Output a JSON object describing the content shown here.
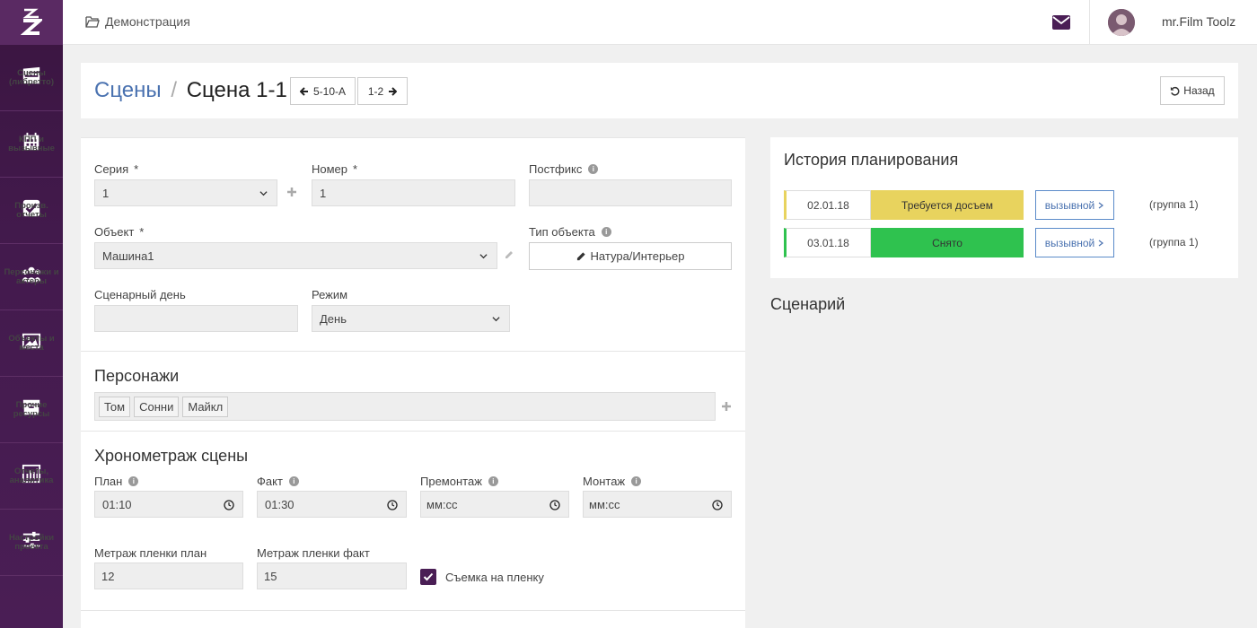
{
  "sidebar": {
    "items": [
      {
        "label": "Сцены (либретто)",
        "icon": "clapperboard-icon"
      },
      {
        "label": "КПП и вызывные",
        "icon": "calendar-icon"
      },
      {
        "label": "Произв. отчеты",
        "icon": "checkbox-icon"
      },
      {
        "label": "Персонажи и актеры",
        "icon": "users-icon"
      },
      {
        "label": "Объекты и места",
        "icon": "image-icon"
      },
      {
        "label": "Прочие ресурсы",
        "icon": "archive-icon"
      },
      {
        "label": "Отчеты, аналитика",
        "icon": "bar-chart-icon"
      },
      {
        "label": "Настройки проекта",
        "icon": "sliders-icon"
      }
    ]
  },
  "topbar": {
    "breadcrumb": "Демонстрация",
    "username": "mr.Film Toolz"
  },
  "header": {
    "title_link": "Сцены",
    "title_separator": "/",
    "title_current": "Сцена 1-1",
    "prev_label": "5-10-А",
    "next_label": "1-2",
    "back_label": "Назад"
  },
  "form": {
    "series_label": "Серия",
    "series_value": "1",
    "number_label": "Номер",
    "number_value": "1",
    "postfix_label": "Постфикс",
    "postfix_value": "",
    "object_label": "Объект",
    "object_value": "Машина1",
    "object_type_label": "Тип объекта",
    "object_type_value": "Натура/Интерьер",
    "script_day_label": "Сценарный день",
    "script_day_value": "",
    "mode_label": "Режим",
    "mode_value": "День",
    "required_mark": "*"
  },
  "characters": {
    "title": "Персонажи",
    "tags": [
      "Том",
      "Сонни",
      "Майкл"
    ]
  },
  "timing": {
    "title": "Хронометраж сцены",
    "plan_label": "План",
    "plan_value": "01:10",
    "fact_label": "Факт",
    "fact_value": "01:30",
    "premontage_label": "Премонтаж",
    "premontage_value": "мм:сс",
    "montage_label": "Монтаж",
    "montage_value": "мм:сс",
    "film_plan_label": "Метраж пленки план",
    "film_plan_value": "12",
    "film_fact_label": "Метраж пленки факт",
    "film_fact_value": "15",
    "film_shoot_label": "Съемка на пленку",
    "film_shoot_checked": true
  },
  "history": {
    "title": "История планирования",
    "rows": [
      {
        "date": "02.01.18",
        "status": "Требуется досъем",
        "status_color": "#e8d35e",
        "link": "вызывной",
        "group": "(группа 1)"
      },
      {
        "date": "03.01.18",
        "status": "Снято",
        "status_color": "#2fc24f",
        "link": "вызывной",
        "group": "(группа 1)"
      }
    ]
  },
  "script": {
    "title": "Сценарий"
  },
  "colors": {
    "sidebar": "#431a4d",
    "accent_link": "#4a72b0",
    "checkbox": "#4a1e55"
  }
}
